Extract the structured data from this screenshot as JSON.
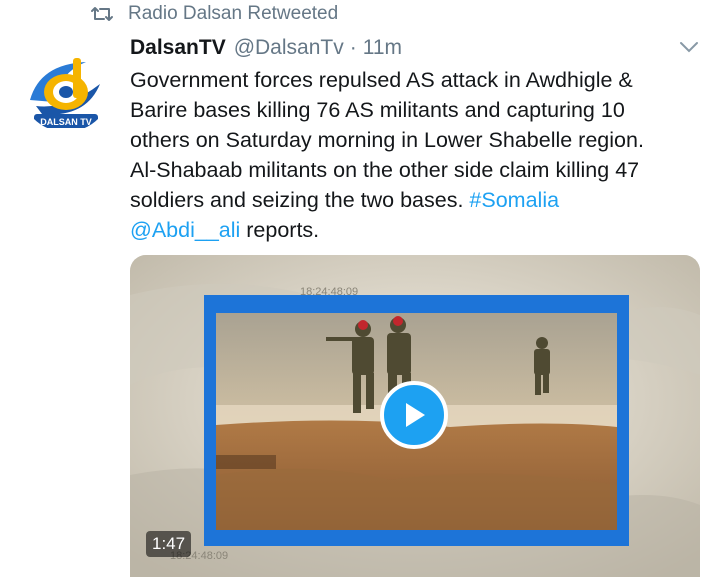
{
  "retweet": {
    "text": "Radio Dalsan Retweeted"
  },
  "tweet": {
    "display_name": "DalsanTV",
    "handle": "@DalsanTv",
    "separator": "·",
    "time": "11m",
    "text_lines": [
      "Government forces repulsed AS attack in Awdhigle &",
      "Barire bases killing 76 AS militants and capturing 10",
      "others on Saturday morning in Lower Shabelle region.",
      "Al-Shabaab militants on the other side claim killing 47",
      "soldiers and seizing the two bases. "
    ],
    "hashtag": "#Somalia",
    "mention": "@Abdi__ali",
    "text_tail": " reports.",
    "avatar_brand": "DALSAN TV",
    "avatar_letter": "d"
  },
  "media": {
    "duration": "1:47",
    "timecode_top": "18:24:48:09",
    "timecode_bottom": "18:24:48:09"
  },
  "colors": {
    "link": "#1da1f2",
    "muted": "#657786",
    "frame_blue": "#1d74d8"
  },
  "icons": [
    "retweet-icon",
    "chevron-down-icon",
    "play-icon"
  ]
}
